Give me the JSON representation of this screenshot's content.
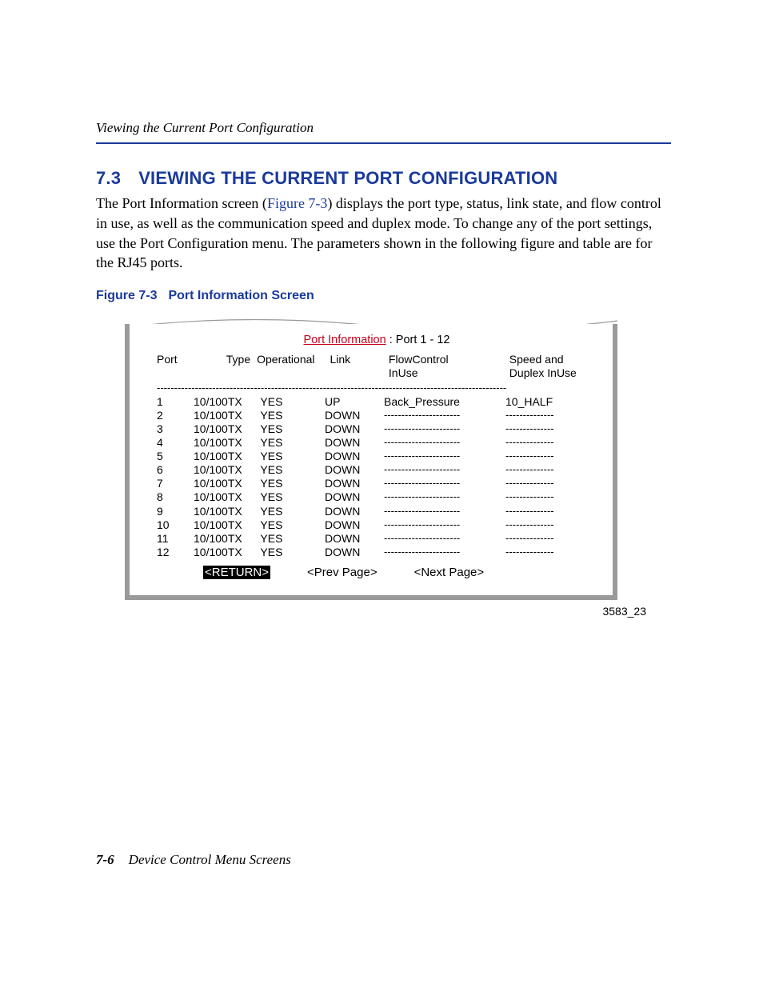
{
  "header": {
    "running_head": "Viewing the Current Port Configuration"
  },
  "section": {
    "number": "7.3",
    "title": "VIEWING THE CURRENT PORT CONFIGURATION",
    "body_pre": "The Port Information screen (",
    "xref": "Figure 7-3",
    "body_post": ") displays the port type, status, link state, and flow control in use, as well as the communication speed and duplex mode. To change any of the port settings, use the Port Configuration menu. The parameters shown in the following figure and table are for the RJ45 ports."
  },
  "figure": {
    "label": "Figure 7-3",
    "caption": "Port Information Screen",
    "image_id": "3583_23"
  },
  "terminal": {
    "title_highlight": "Port Information",
    "title_rest": " : Port  1 - 12",
    "columns": {
      "port": "Port",
      "type": "Type",
      "operational": "Operational",
      "link": "Link",
      "flowcontrol_l1": "FlowControl",
      "flowcontrol_l2": "InUse",
      "speed_l1": "Speed and",
      "speed_l2": "Duplex InUse"
    },
    "separator": "-----------------------------------------------------------------------------------------------------",
    "fc_dash": "----------------------",
    "sd_dash": "--------------",
    "rows": [
      {
        "port": "1",
        "type": "10/100TX",
        "op": "YES",
        "link": "UP",
        "fc": "Back_Pressure",
        "sd": "10_HALF"
      },
      {
        "port": "2",
        "type": "10/100TX",
        "op": "YES",
        "link": "DOWN",
        "fc": "",
        "sd": ""
      },
      {
        "port": "3",
        "type": "10/100TX",
        "op": "YES",
        "link": "DOWN",
        "fc": "",
        "sd": ""
      },
      {
        "port": "4",
        "type": "10/100TX",
        "op": "YES",
        "link": "DOWN",
        "fc": "",
        "sd": ""
      },
      {
        "port": "5",
        "type": "10/100TX",
        "op": "YES",
        "link": "DOWN",
        "fc": "",
        "sd": ""
      },
      {
        "port": "6",
        "type": "10/100TX",
        "op": "YES",
        "link": "DOWN",
        "fc": "",
        "sd": ""
      },
      {
        "port": "7",
        "type": "10/100TX",
        "op": "YES",
        "link": "DOWN",
        "fc": "",
        "sd": ""
      },
      {
        "port": "8",
        "type": "10/100TX",
        "op": "YES",
        "link": "DOWN",
        "fc": "",
        "sd": ""
      },
      {
        "port": "9",
        "type": "10/100TX",
        "op": "YES",
        "link": "DOWN",
        "fc": "",
        "sd": ""
      },
      {
        "port": "10",
        "type": "10/100TX",
        "op": "YES",
        "link": "DOWN",
        "fc": "",
        "sd": ""
      },
      {
        "port": "11",
        "type": "10/100TX",
        "op": "YES",
        "link": "DOWN",
        "fc": "",
        "sd": ""
      },
      {
        "port": "12",
        "type": "10/100TX",
        "op": "YES",
        "link": "DOWN",
        "fc": "",
        "sd": ""
      }
    ],
    "nav": {
      "return": "<RETURN>",
      "prev": "<Prev Page>",
      "next": "<Next Page>"
    }
  },
  "footer": {
    "page": "7-6",
    "chapter": "Device Control Menu Screens"
  }
}
